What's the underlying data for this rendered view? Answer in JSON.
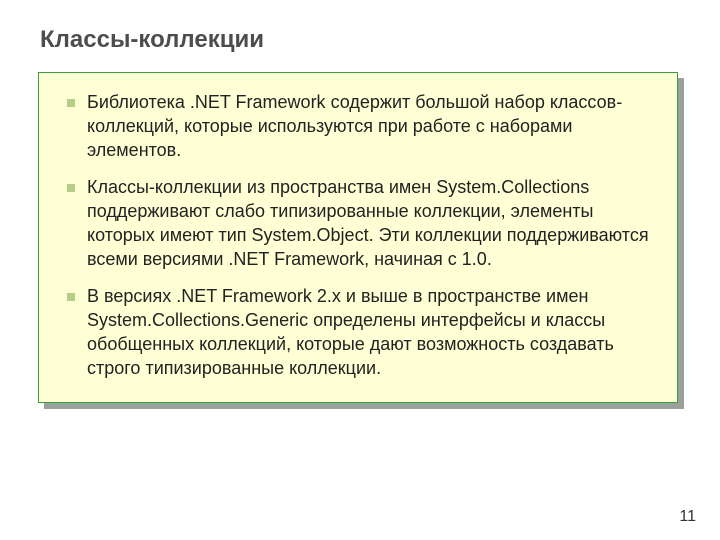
{
  "title": "Классы-коллекции",
  "bullets": [
    " Библиотека .NET Framework содержит большой набор классов-коллекций, которые используются при работе с наборами элементов.",
    " Классы-коллекции из пространства имен System.Collections поддерживают слабо типизированные коллекции, элементы которых имеют тип System.Object.  Эти коллекции поддерживаются всеми версиями .NET Framework, начиная с 1.0.",
    " В версиях .NET Framework 2.x  и выше в пространстве имен System.Collections.Generic определены интерфейсы и классы обобщенных коллекций, которые дают возможность создавать строго типизированные коллекции."
  ],
  "page_number": "11"
}
